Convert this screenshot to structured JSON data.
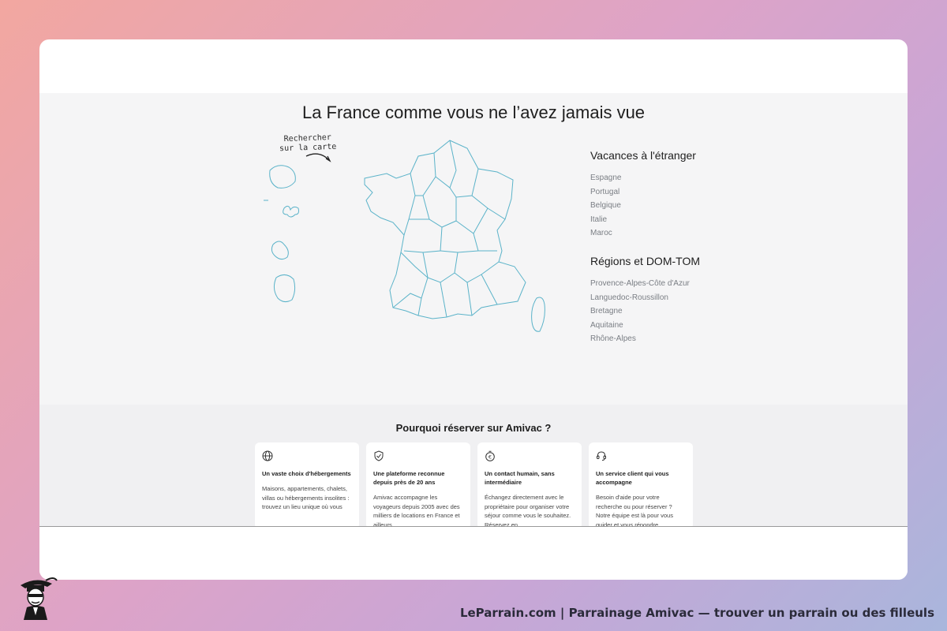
{
  "hero": {
    "title": "La France comme vous ne l’avez jamais vue",
    "map_note": "Rechercher sur la carte"
  },
  "abroad": {
    "heading": "Vacances à l'étranger",
    "items": [
      "Espagne",
      "Portugal",
      "Belgique",
      "Italie",
      "Maroc"
    ]
  },
  "regions": {
    "heading": "Régions et DOM-TOM",
    "items": [
      "Provence-Alpes-Côte d'Azur",
      "Languedoc-Roussillon",
      "Bretagne",
      "Aquitaine",
      "Rhône-Alpes"
    ]
  },
  "why": {
    "title": "Pourquoi réserver sur Amivac ?",
    "features": [
      {
        "icon": "globe-icon",
        "title": "Un vaste choix d'hébergements",
        "text": "Maisons, appartements, chalets, villas ou hébergements insolites : trouvez un lieu unique où vous"
      },
      {
        "icon": "shield-check-icon",
        "title": "Une plateforme reconnue depuis près de 20 ans",
        "text": "Amivac accompagne les voyageurs depuis 2005 avec des milliers de locations en France et ailleurs."
      },
      {
        "icon": "timer-euro-icon",
        "title": "Un contact humain, sans intermédiaire",
        "text": "Échangez directement avec le propriétaire pour organiser votre séjour comme vous le souhaitez. Réservez en"
      },
      {
        "icon": "headset-icon",
        "title": "Un service client qui vous accompagne",
        "text": "Besoin d'aide pour votre recherche ou pour réserver ? Notre équipe est là pour vous guider et vous répondre"
      }
    ]
  },
  "footer": {
    "caption": "LeParrain.com | Parrainage Amivac — trouver un parrain ou des filleuls"
  },
  "colors": {
    "map_stroke": "#5bb3c9",
    "link_gray": "#7a7e84"
  }
}
